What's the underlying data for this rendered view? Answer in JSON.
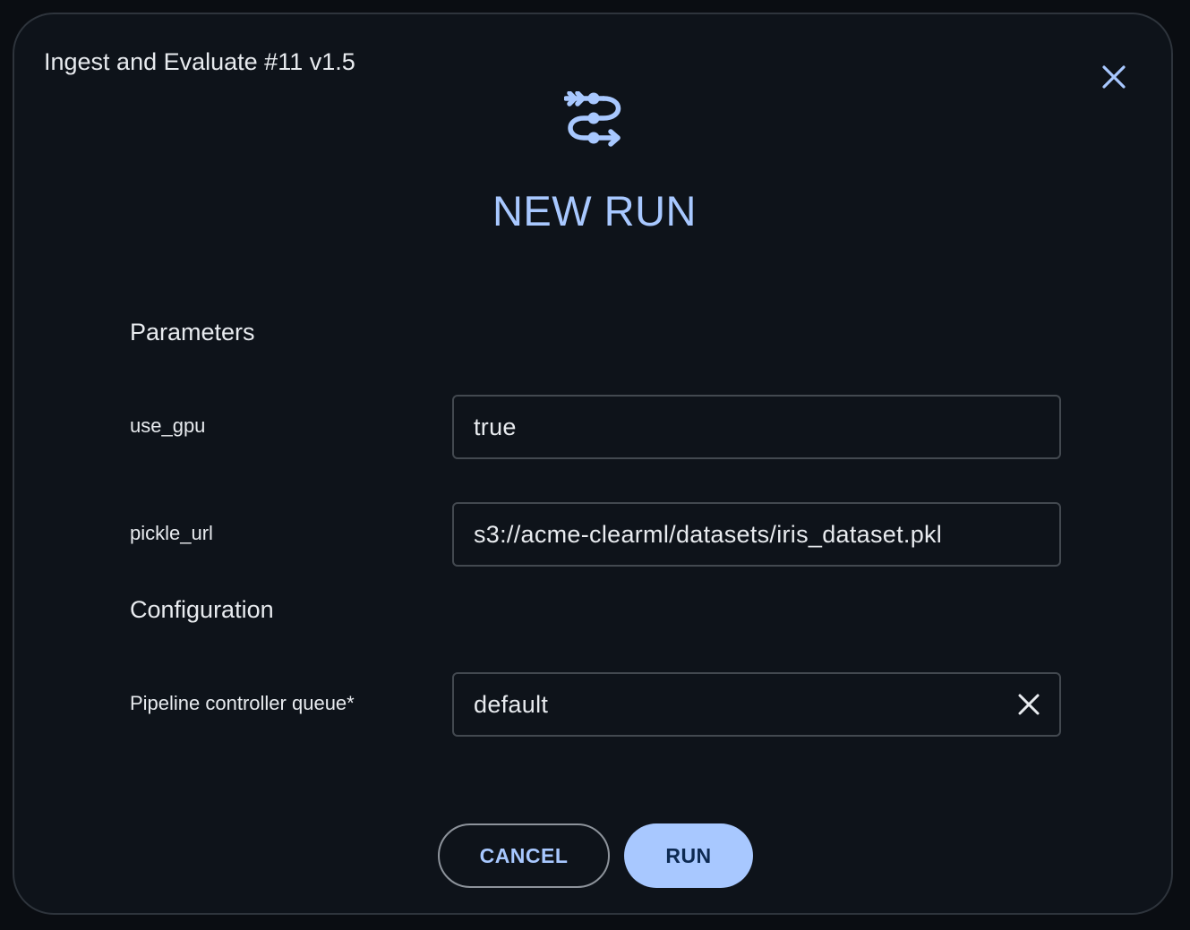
{
  "dialog": {
    "title": "Ingest and Evaluate #11 v1.5",
    "heading": "NEW RUN",
    "header_icon": "pipeline-icon",
    "close_icon": "close-icon"
  },
  "parameters": {
    "section_title": "Parameters",
    "fields": [
      {
        "label": "use_gpu",
        "value": "true"
      },
      {
        "label": "pickle_url",
        "value": "s3://acme-clearml/datasets/iris_dataset.pkl"
      }
    ]
  },
  "configuration": {
    "section_title": "Configuration",
    "fields": [
      {
        "label": "Pipeline controller queue*",
        "value": "default",
        "clear_icon": "clear-icon"
      }
    ]
  },
  "actions": {
    "cancel_label": "CANCEL",
    "run_label": "RUN"
  },
  "colors": {
    "accent": "#a8c8ff",
    "background": "#0e131a",
    "run_text": "#0d2a52"
  }
}
